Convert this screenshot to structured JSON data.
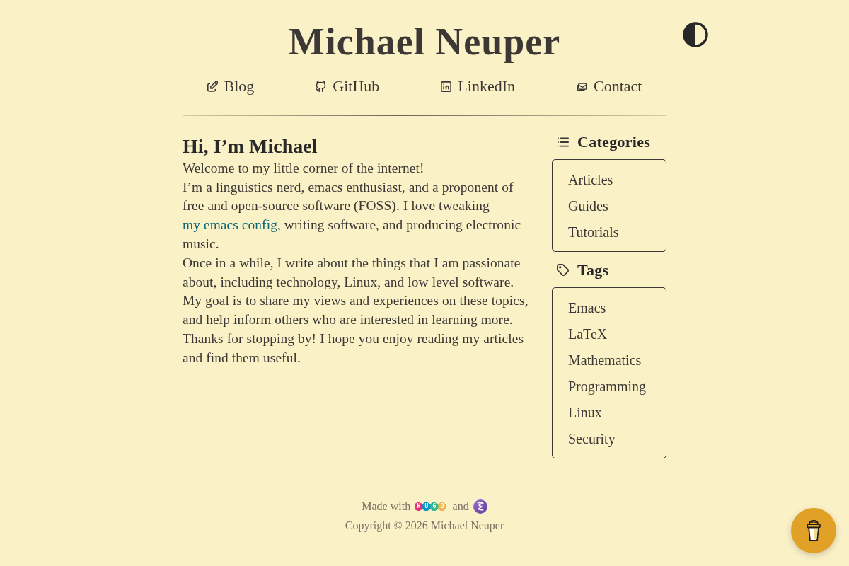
{
  "header": {
    "title": "Michael Neuper"
  },
  "nav": [
    {
      "label": "Blog",
      "kind": "blog"
    },
    {
      "label": "GitHub",
      "kind": "github"
    },
    {
      "label": "LinkedIn",
      "kind": "linkedin"
    },
    {
      "label": "Contact",
      "kind": "contact"
    }
  ],
  "main": {
    "heading": "Hi, I’m Michael",
    "paragraphs": [
      {
        "segments": [
          {
            "text": "Welcome to my little corner of the internet!",
            "link": false
          }
        ]
      },
      {
        "segments": [
          {
            "text": "I’m a linguistics nerd, emacs enthusiast, and a proponent of free and open-source software (FOSS). I love tweaking ",
            "link": false
          },
          {
            "text": "my emacs config",
            "link": true
          },
          {
            "text": ", writing software, and producing electronic music.",
            "link": false
          }
        ]
      },
      {
        "segments": [
          {
            "text": "Once in a while, I write about the things that I am passionate about, including technology, Linux, and low level software.",
            "link": false
          }
        ]
      },
      {
        "segments": [
          {
            "text": "My goal is to share my views and experiences on these topics, and help inform others who are interested in learning more.",
            "link": false
          }
        ]
      },
      {
        "segments": [
          {
            "text": "Thanks for stopping by! I hope you enjoy reading my articles and find them useful.",
            "link": false
          }
        ]
      }
    ]
  },
  "sidebar": [
    {
      "title": "Categories",
      "kind": "categories",
      "items": [
        "Articles",
        "Guides",
        "Tutorials"
      ]
    },
    {
      "title": "Tags",
      "kind": "tags",
      "items": [
        "Emacs",
        "LaTeX",
        "Mathematics",
        "Programming",
        "Linux",
        "Security"
      ]
    }
  ],
  "footer": {
    "made_with": "Made with",
    "hugo_logo": "HUGO",
    "and": "and",
    "copyright": "Copyright © 2026 Michael Neuper"
  }
}
